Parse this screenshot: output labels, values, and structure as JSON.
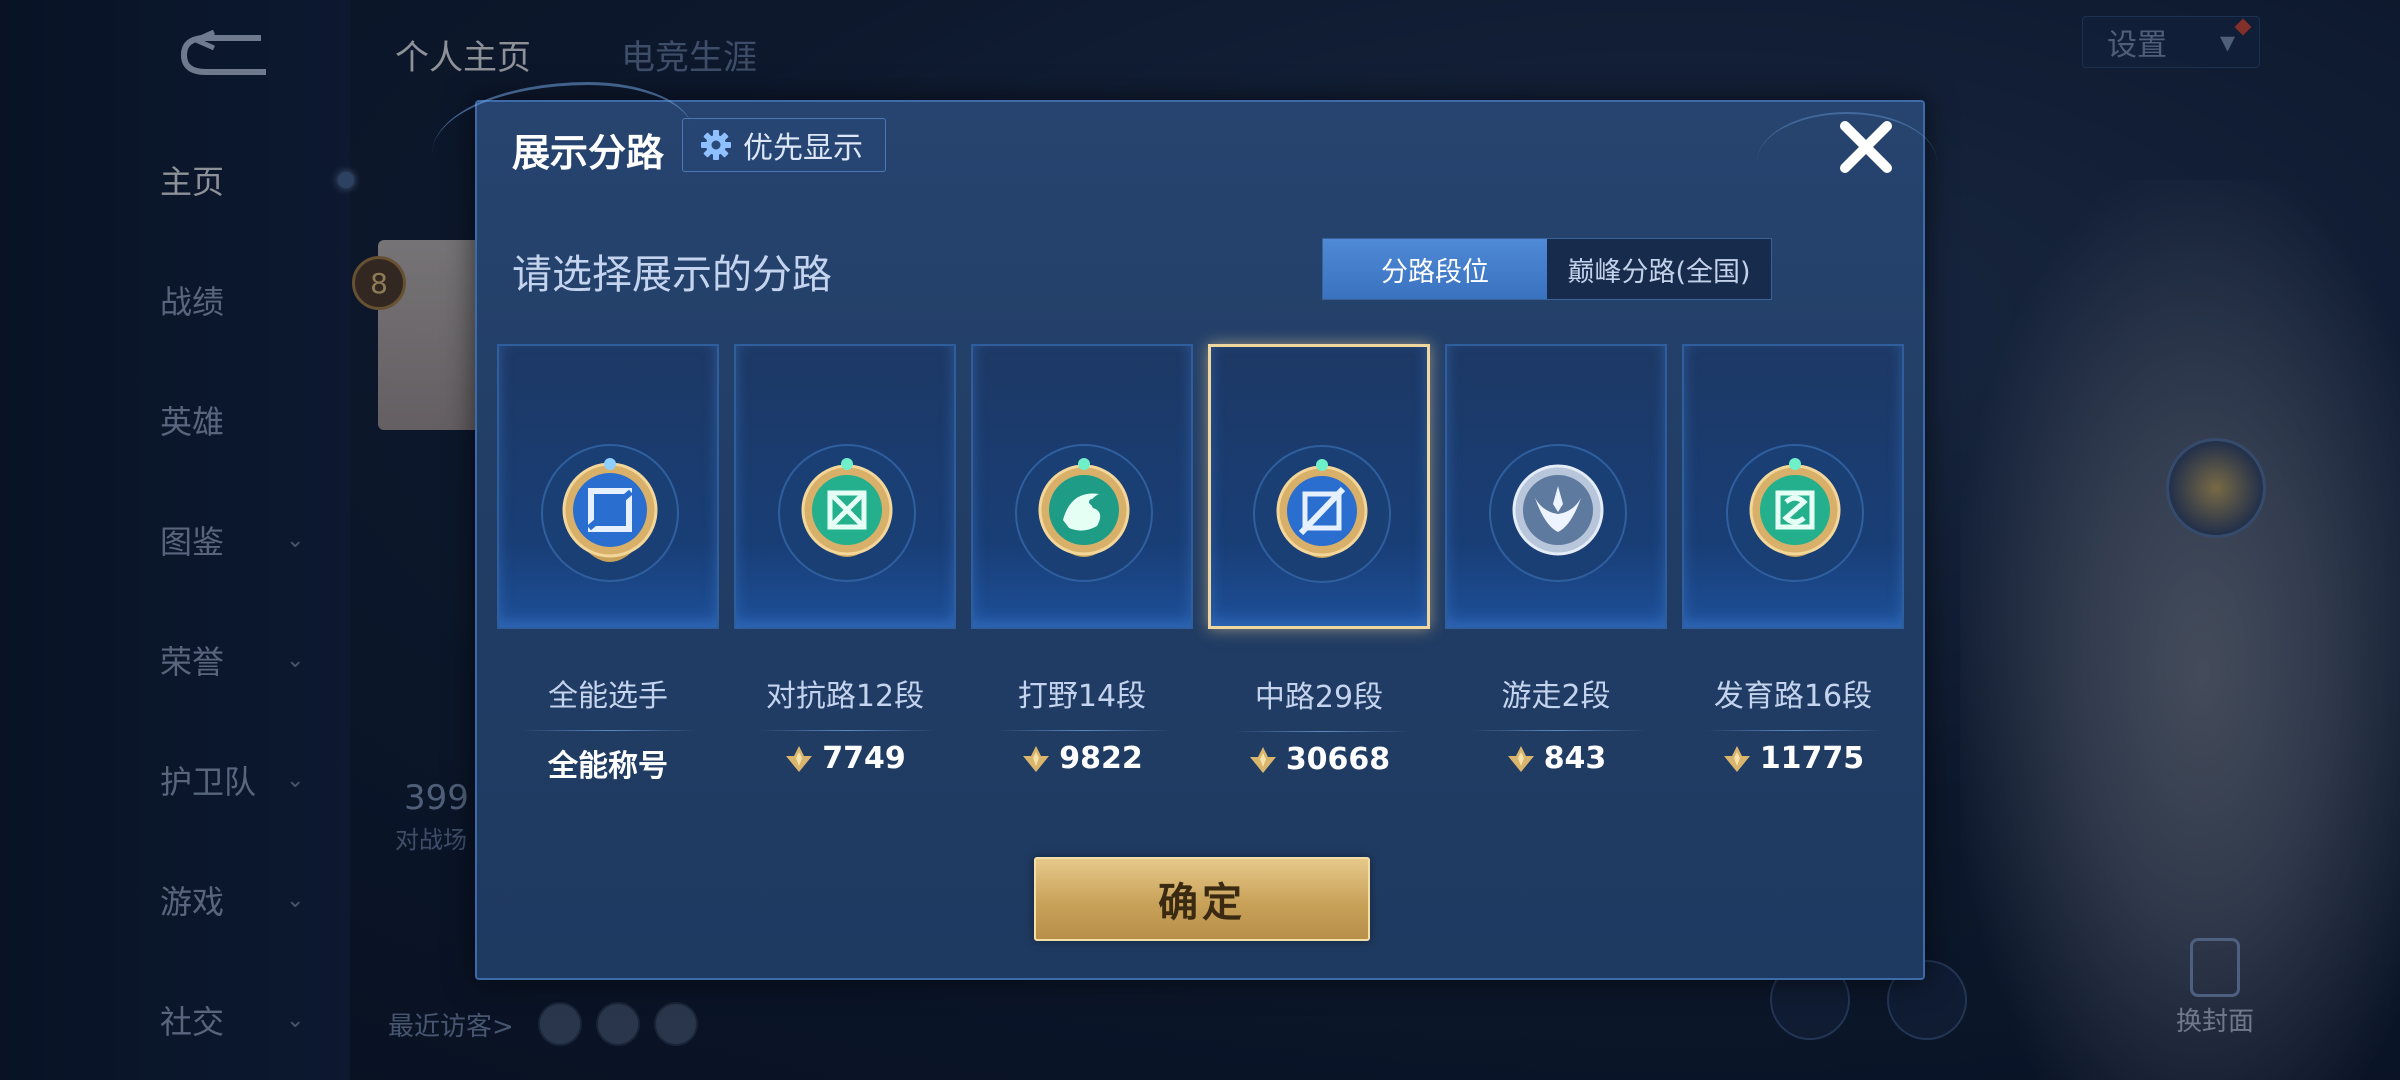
{
  "sidebar": {
    "items": [
      {
        "label": "主页",
        "active": true,
        "chevron": false
      },
      {
        "label": "战绩",
        "active": false,
        "chevron": false
      },
      {
        "label": "英雄",
        "active": false,
        "chevron": false
      },
      {
        "label": "图鉴",
        "active": false,
        "chevron": true
      },
      {
        "label": "荣誉",
        "active": false,
        "chevron": true
      },
      {
        "label": "护卫队",
        "active": false,
        "chevron": true
      },
      {
        "label": "游戏",
        "active": false,
        "chevron": true
      },
      {
        "label": "社交",
        "active": false,
        "chevron": true
      }
    ]
  },
  "header": {
    "tabs": [
      {
        "label": "个人主页"
      },
      {
        "label": "电竞生涯"
      }
    ],
    "settings_label": "设置"
  },
  "profile": {
    "level": "8",
    "stat_value": "399",
    "stat_label": "对战场",
    "visitors_label": "最近访客>"
  },
  "skin_button_label": "换封面",
  "modal": {
    "title": "展示分路",
    "priority_label": "优先显示",
    "section_title": "请选择展示的分路",
    "toggle": [
      {
        "label": "分路段位",
        "active": true
      },
      {
        "label": "巅峰分路(全国)",
        "active": false
      }
    ],
    "cards": [
      {
        "name": "全能选手",
        "value": "全能称号",
        "show_peak_icon": false,
        "selected": false,
        "emblem": "all-round-emblem-icon",
        "gem_color": "#4f8fe0"
      },
      {
        "name": "对抗路12段",
        "value": "7749",
        "show_peak_icon": true,
        "selected": false,
        "emblem": "clash-lane-emblem-icon",
        "gem_color": "#35c9a0"
      },
      {
        "name": "打野14段",
        "value": "9822",
        "show_peak_icon": true,
        "selected": false,
        "emblem": "jungle-emblem-icon",
        "gem_color": "#2fb59a"
      },
      {
        "name": "中路29段",
        "value": "30668",
        "show_peak_icon": true,
        "selected": true,
        "emblem": "mid-lane-emblem-icon",
        "gem_color": "#4f8fe0"
      },
      {
        "name": "游走2段",
        "value": "843",
        "show_peak_icon": true,
        "selected": false,
        "emblem": "roam-emblem-icon",
        "gem_color": "#8fa7c6"
      },
      {
        "name": "发育路16段",
        "value": "11775",
        "show_peak_icon": true,
        "selected": false,
        "emblem": "farm-lane-emblem-icon",
        "gem_color": "#35c9a0"
      }
    ],
    "confirm_label": "确定"
  },
  "colors": {
    "accent_blue": "#3a72c0",
    "gold": "#c9a25a",
    "selected_border": "#f0d7a0"
  }
}
